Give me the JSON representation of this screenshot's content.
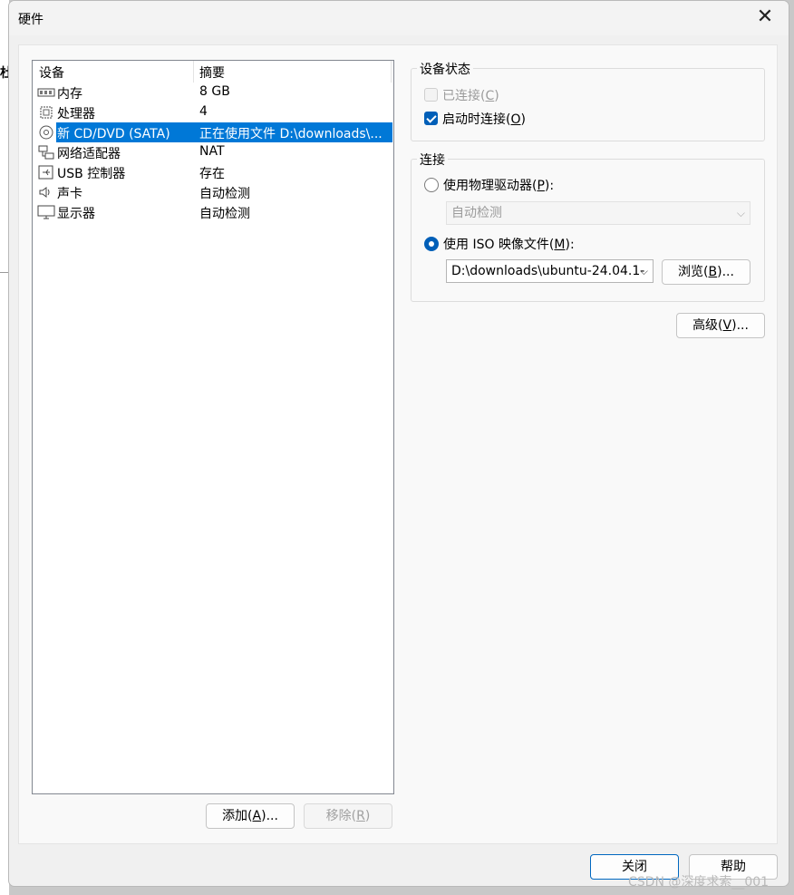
{
  "dialog": {
    "title": "硬件",
    "close_glyph": "✕"
  },
  "background": {
    "edge_text": "杜"
  },
  "device_list": {
    "headers": [
      "设备",
      "摘要"
    ],
    "items": [
      {
        "name": "内存",
        "summary": "8 GB",
        "icon": "memory-icon"
      },
      {
        "name": "处理器",
        "summary": "4",
        "icon": "processor-icon"
      },
      {
        "name": "新 CD/DVD (SATA)",
        "summary": "正在使用文件 D:\\downloads\\...",
        "icon": "cd-dvd-icon",
        "selected": true
      },
      {
        "name": "网络适配器",
        "summary": "NAT",
        "icon": "network-adapter-icon"
      },
      {
        "name": "USB 控制器",
        "summary": "存在",
        "icon": "usb-icon"
      },
      {
        "name": "声卡",
        "summary": "自动检测",
        "icon": "sound-card-icon"
      },
      {
        "name": "显示器",
        "summary": "自动检测",
        "icon": "display-icon"
      }
    ],
    "add_label_pre": "添加(",
    "add_key": "A",
    "add_label_post": ")...",
    "remove_label_pre": "移除(",
    "remove_key": "R",
    "remove_label_post": ")"
  },
  "device_status": {
    "title": "设备状态",
    "connected_pre": "已连接(",
    "connected_key": "C",
    "connected_post": ")",
    "connected_checked": false,
    "connect_on_start_pre": "启动时连接(",
    "connect_on_start_key": "O",
    "connect_on_start_post": ")",
    "connect_on_start_checked": true
  },
  "connection": {
    "title": "连接",
    "physical_pre": "使用物理驱动器(",
    "physical_key": "P",
    "physical_post": "):",
    "physical_value": "自动检测",
    "iso_pre": "使用 ISO 映像文件(",
    "iso_key": "M",
    "iso_post": "):",
    "iso_value": "D:\\downloads\\ubuntu-24.04.1-",
    "browse_pre": "浏览(",
    "browse_key": "B",
    "browse_post": ")...",
    "selected": "iso"
  },
  "advanced": {
    "pre": "高级(",
    "key": "V",
    "post": ")..."
  },
  "footer": {
    "close_label": "关闭",
    "help_label": "帮助"
  },
  "watermark": "CSDN @深度求索__001",
  "colors": {
    "selection": "#0078d7",
    "accent": "#005fb8"
  }
}
